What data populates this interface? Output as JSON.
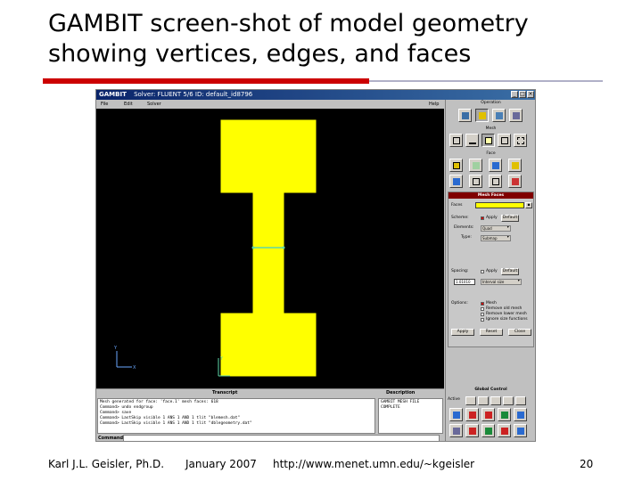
{
  "slide": {
    "title": "GAMBIT screen-shot of model geometry showing vertices, edges, and faces",
    "footer_author": "Karl J.L. Geisler, Ph.D.",
    "footer_date": "January 2007",
    "footer_url": "http://www.menet.umn.edu/~kgeisler",
    "page_number": "20",
    "rule_colors": [
      "#cc0000",
      "#b0b0c8"
    ]
  },
  "gambit": {
    "title_app": "GAMBIT",
    "title_info": "Solver: FLUENT 5/6   ID: default_id8796",
    "menu": {
      "file": "File",
      "edit": "Edit",
      "solver": "Solver",
      "help": "Help"
    },
    "viewport": {
      "background": "#000000",
      "geometry_color": "#ffff00",
      "edge_color": "#5fd7a8",
      "axes_x_label": "X",
      "axes_y_label": "Y"
    },
    "transcript_label": "Transcript",
    "description_label": "Description",
    "transcript_lines": [
      "Mesh generated for face: 'face.1' mesh faces: 618",
      "Command> undo endgroup",
      "Command> save",
      "Command> LastSkip visible 1 ANS 1 AND 1 tlit \"blemesh.dat\"",
      "Command> LastSkip visible 1 ANS 1 AND 1 tlit \"dblegeometry.dat\""
    ],
    "description_lines": [
      "GAMBIT MESH FILE",
      "COMPLETE"
    ],
    "command_label": "Command:",
    "command_value": "",
    "panel": {
      "operation_label": "Operation",
      "mesh_label": "Mesh",
      "face_label": "Face",
      "form_title": "Mesh Faces",
      "faces_label": "Faces",
      "faces_value": "",
      "scheme_label": "Scheme:",
      "apply_label": "Apply",
      "default_label": "Default",
      "elements_label": "Elements:",
      "elements_value": "Quad",
      "type_label": "Type:",
      "type_value": "Submap",
      "spacing_label": "Spacing:",
      "spacing_value": "1.01010",
      "spacing_unit": "Interval size",
      "options_label": "Options:",
      "option_mesh": "Mesh",
      "option_remove": "Remove old mesh",
      "option_lower": "Remove lower mesh",
      "option_ignore": "Ignore size functions",
      "btn_apply": "Apply",
      "btn_reset": "Reset",
      "btn_close": "Close",
      "global_control_label": "Global Control",
      "active_label": "Active"
    }
  }
}
